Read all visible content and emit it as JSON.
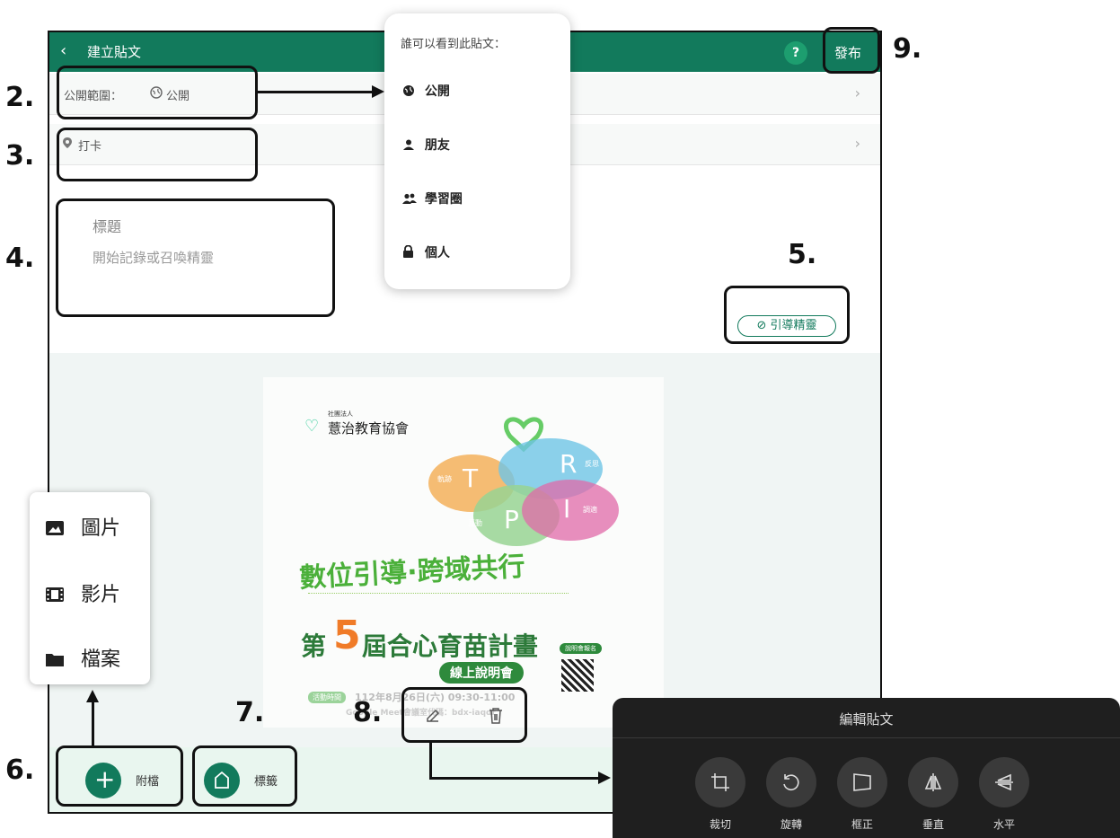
{
  "header": {
    "back_icon": "chevron-left-icon",
    "title": "建立貼文",
    "help_label": "?",
    "publish_label": "發布"
  },
  "privacy_row": {
    "label": "公開範圍：",
    "value": "公開",
    "icon": "globe-icon"
  },
  "checkin_row": {
    "label": "打卡",
    "icon": "location-pin-icon"
  },
  "editor": {
    "title_placeholder": "標題",
    "content_placeholder": "開始記錄或召喚精靈"
  },
  "guide_button": {
    "label": "引導精靈",
    "icon": "compass-icon"
  },
  "audience_menu": {
    "title": "誰可以看到此貼文：",
    "options": [
      {
        "label": "公開",
        "icon": "globe-icon"
      },
      {
        "label": "朋友",
        "icon": "person-icon"
      },
      {
        "label": "學習圈",
        "icon": "group-icon"
      },
      {
        "label": "個人",
        "icon": "lock-icon"
      }
    ]
  },
  "attach_menu": {
    "options": [
      {
        "label": "圖片",
        "icon": "image-icon"
      },
      {
        "label": "影片",
        "icon": "film-icon"
      },
      {
        "label": "檔案",
        "icon": "folder-icon"
      }
    ]
  },
  "bottom_bar": {
    "attach_label": "附檔",
    "tag_label": "標籤"
  },
  "poster": {
    "org": "薏治教育協會",
    "org_small": "社團法人",
    "letters": [
      "T",
      "R",
      "P",
      "I"
    ],
    "bubble_labels": [
      "軌跡",
      "反思",
      "互動",
      "調適"
    ],
    "slogan": "數位引導·跨域共行",
    "headline_pre": "第",
    "headline_num": "5",
    "headline_post": "屆合心育苗計畫",
    "sub": "線上說明會",
    "register": "說明會報名",
    "date_tag": "活動時間",
    "date": "112年8月26日(六) 09:30-11:00",
    "meet": "Google Meet會議室代碼：bdx-iaqdr"
  },
  "edit_panel": {
    "title": "編輯貼文",
    "tools": [
      {
        "label": "裁切",
        "icon": "crop-icon"
      },
      {
        "label": "旋轉",
        "icon": "rotate-icon"
      },
      {
        "label": "框正",
        "icon": "perspective-icon"
      },
      {
        "label": "垂直",
        "icon": "flip-vertical-icon"
      },
      {
        "label": "水平",
        "icon": "flip-horizontal-icon"
      }
    ]
  },
  "steps": [
    "2.",
    "3.",
    "4.",
    "5.",
    "6.",
    "7.",
    "8.",
    "9."
  ],
  "colors": {
    "primary": "#127a5c",
    "accent": "#1d9e6f",
    "bar_bg": "#e9f6ef",
    "panel_bg": "#1f1f1f"
  }
}
